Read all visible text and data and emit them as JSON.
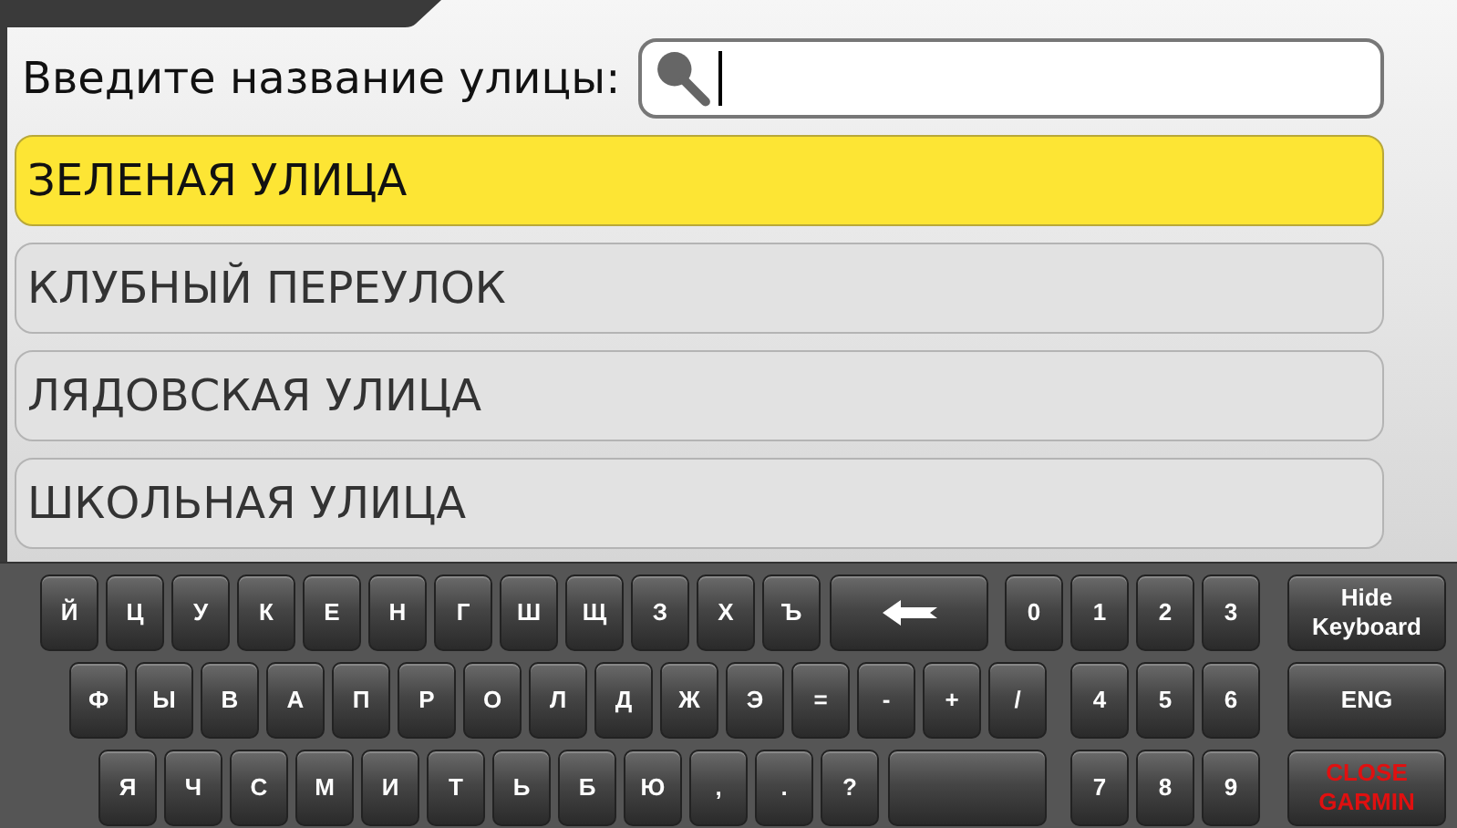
{
  "search": {
    "label": "Введите название улицы:"
  },
  "results": [
    {
      "name": "ЗЕЛЕНАЯ УЛИЦА",
      "selected": true
    },
    {
      "name": "КЛУБНЫЙ ПЕРЕУЛОК",
      "selected": false
    },
    {
      "name": "ЛЯДОВСКАЯ УЛИЦА",
      "selected": false
    },
    {
      "name": "ШКОЛЬНАЯ УЛИЦА",
      "selected": false
    }
  ],
  "keyboard": [
    {
      "keys": [
        "Й",
        "Ц",
        "У",
        "К",
        "Е",
        "Н",
        "Г",
        "Ш",
        "Щ",
        "З",
        "Х",
        "Ъ"
      ],
      "extra": {
        "kind": "backspace"
      },
      "digits": [
        "0",
        "1",
        "2",
        "3"
      ],
      "action": {
        "label": "Hide Keyboard",
        "kind": "normal"
      }
    },
    {
      "keys": [
        "Ф",
        "Ы",
        "В",
        "А",
        "П",
        "Р",
        "О",
        "Л",
        "Д",
        "Ж",
        "Э",
        "=",
        "-",
        "+",
        "/"
      ],
      "digits": [
        "4",
        "5",
        "6"
      ],
      "action": {
        "label": "ENG",
        "kind": "normal"
      }
    },
    {
      "keys": [
        "Я",
        "Ч",
        "С",
        "М",
        "И",
        "Т",
        "Ь",
        "Б",
        "Ю",
        ",",
        ".",
        "?"
      ],
      "extra": {
        "kind": "space"
      },
      "digits": [
        "7",
        "8",
        "9"
      ],
      "action": {
        "label": "CLOSE GARMIN",
        "kind": "danger"
      }
    }
  ]
}
